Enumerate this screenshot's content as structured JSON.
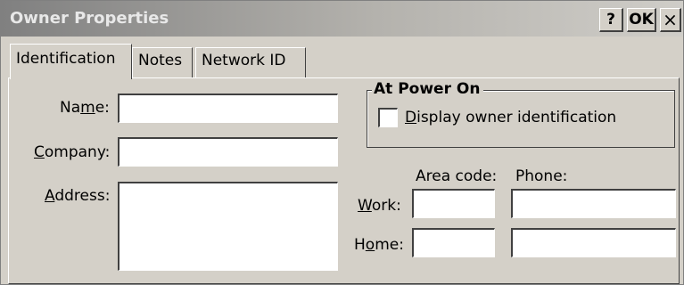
{
  "window": {
    "title": "Owner Properties",
    "help_label": "?",
    "ok_label": "OK",
    "close_label": "×"
  },
  "tabs": [
    {
      "label": "Identification",
      "active": true
    },
    {
      "label": "Notes",
      "active": false
    },
    {
      "label": "Network ID",
      "active": false
    }
  ],
  "identification": {
    "name_label_pre": "Na",
    "name_label_mnemonic": "m",
    "name_label_post": "e:",
    "name_value": "",
    "company_label_mnemonic": "C",
    "company_label_post": "ompany:",
    "company_value": "",
    "address_label_mnemonic": "A",
    "address_label_post": "ddress:",
    "address_value": ""
  },
  "power_on": {
    "group_title": "At Power On",
    "checkbox_label_mnemonic": "D",
    "checkbox_label_post": "isplay owner identification",
    "checked": false
  },
  "phone": {
    "area_code_header": "Area code:",
    "phone_header": "Phone:",
    "work_label_mnemonic": "W",
    "work_label_post": "ork:",
    "home_label_pre": "H",
    "home_label_mnemonic": "o",
    "home_label_post": "me:",
    "work_area": "",
    "work_phone": "",
    "home_area": "",
    "home_phone": ""
  }
}
